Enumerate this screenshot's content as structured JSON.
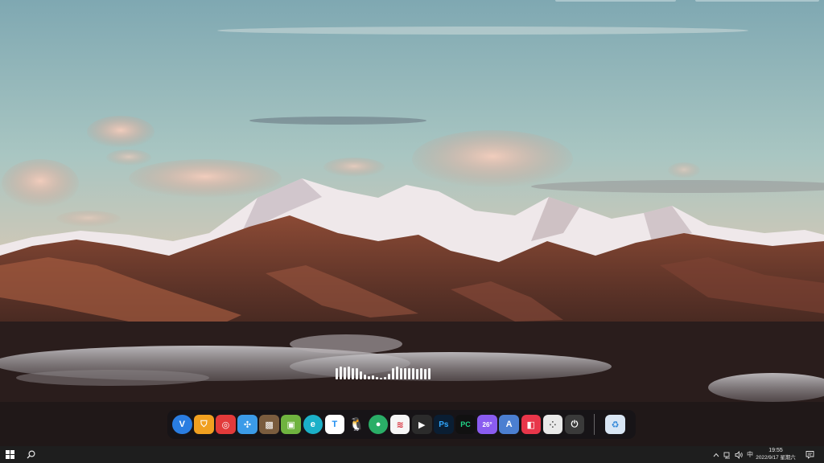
{
  "desktop": {
    "wallpaper": "snowy-mountain-range-sunset",
    "colors": {
      "sky_top": "#8fb4b8",
      "sky_bottom": "#e7c7aa",
      "mountain_dark": "#4a2c24",
      "snow": "#f2eef0",
      "cloud": "#d9a897"
    }
  },
  "audio_visualizer": {
    "levels": [
      0.9,
      1.0,
      0.95,
      1.0,
      0.9,
      0.85,
      0.6,
      0.4,
      0.25,
      0.3,
      0.2,
      0.15,
      0.2,
      0.45,
      0.9,
      1.0,
      0.85,
      0.85,
      0.9,
      0.85,
      0.8,
      0.85,
      0.8,
      0.85
    ]
  },
  "dock": {
    "apps": [
      {
        "id": "app-v",
        "icon": "v-circle-icon",
        "color": "#2a7de1",
        "glyph": "V"
      },
      {
        "id": "app-shield",
        "icon": "shield-icon",
        "color": "#f0a020",
        "glyph": "⛉"
      },
      {
        "id": "app-netease-music",
        "icon": "netease-music-icon",
        "color": "#e23a3a",
        "glyph": "◎"
      },
      {
        "id": "app-pinwheel",
        "icon": "pinwheel-icon",
        "color": "#3b9be8",
        "glyph": "✣"
      },
      {
        "id": "app-game-1",
        "icon": "game-art-icon",
        "color": "#7a5c3e",
        "glyph": "▩"
      },
      {
        "id": "app-minecraft",
        "icon": "minecraft-icon",
        "color": "#6fb33f",
        "glyph": "▣"
      },
      {
        "id": "app-edge",
        "icon": "edge-icon",
        "color": "#1bb0c8",
        "glyph": "e"
      },
      {
        "id": "app-t",
        "icon": "t-app-icon",
        "color": "#ffffff",
        "glyph": "T"
      },
      {
        "id": "app-qq",
        "icon": "qq-penguin-icon",
        "color": "#1a1a1a",
        "glyph": "🐧"
      },
      {
        "id": "app-wechat",
        "icon": "wechat-icon",
        "color": "#2aae67",
        "glyph": "●"
      },
      {
        "id": "app-red-list",
        "icon": "notes-red-icon",
        "color": "#f6f6f6",
        "glyph": "≋"
      },
      {
        "id": "app-media",
        "icon": "media-player-icon",
        "color": "#2b2b2b",
        "glyph": "▶"
      },
      {
        "id": "app-photoshop",
        "icon": "photoshop-icon",
        "color": "#0a1e33",
        "glyph": "Ps"
      },
      {
        "id": "app-pycharm",
        "icon": "pycharm-icon",
        "color": "#111111",
        "glyph": "PC"
      },
      {
        "id": "app-weather",
        "icon": "weather-cloud-icon",
        "color": "#8a5cf0",
        "glyph": "26°"
      },
      {
        "id": "app-store",
        "icon": "app-store-icon",
        "color": "#4b7fd1",
        "glyph": "A"
      },
      {
        "id": "app-red-square",
        "icon": "red-cards-icon",
        "color": "#e8364a",
        "glyph": "◧"
      },
      {
        "id": "app-launcher",
        "icon": "launcher-grid-icon",
        "color": "#e9e9e9",
        "glyph": "⁘"
      },
      {
        "id": "app-power",
        "icon": "power-icon",
        "color": "#3a3a3a",
        "glyph": "⏻"
      }
    ],
    "trash": {
      "id": "recycle-bin",
      "icon": "recycle-bin-icon",
      "color": "#d8e6f4",
      "glyph": "♻"
    }
  },
  "taskbar": {
    "start_icon": "windows-logo-icon",
    "search_icon": "search-icon",
    "tray": {
      "chevron": "^",
      "network_icon": "network-icon",
      "volume_icon": "volume-icon",
      "ime": "中"
    },
    "clock": {
      "time": "19:55",
      "date": "2022/9/17 星期六"
    },
    "notification_icon": "notification-icon"
  }
}
